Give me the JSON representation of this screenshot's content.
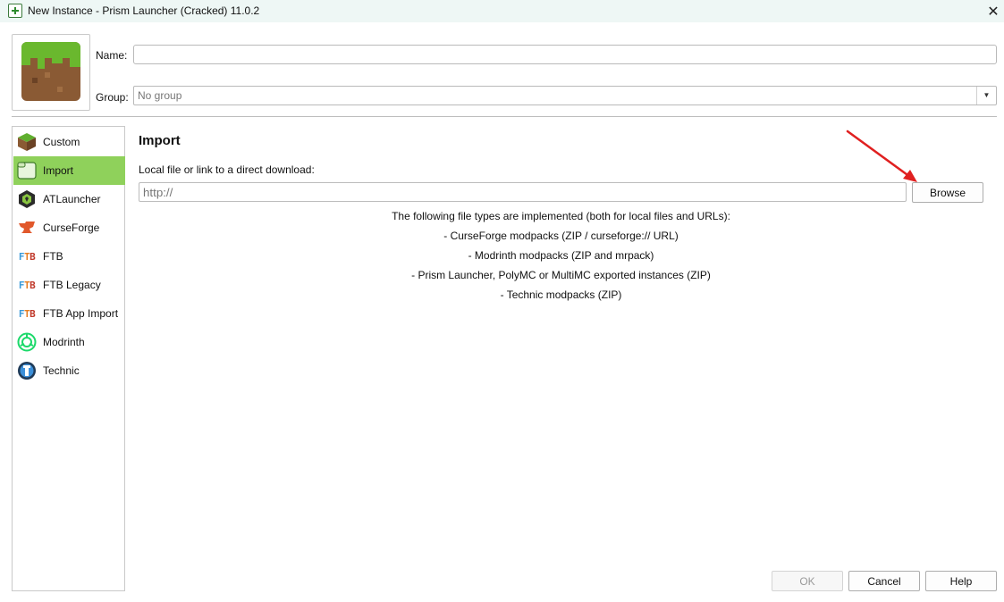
{
  "window": {
    "title": "New Instance - Prism Launcher (Cracked) 11.0.2",
    "close_glyph": "✕"
  },
  "header": {
    "name_label": "Name:",
    "name_value": "",
    "group_label": "Group:",
    "group_placeholder": "No group"
  },
  "sidebar": {
    "items": [
      {
        "label": "Custom",
        "icon": "grass-block-icon",
        "selected": false
      },
      {
        "label": "Import",
        "icon": "folder-icon",
        "selected": true
      },
      {
        "label": "ATLauncher",
        "icon": "atlauncher-icon",
        "selected": false
      },
      {
        "label": "CurseForge",
        "icon": "curseforge-icon",
        "selected": false
      },
      {
        "label": "FTB",
        "icon": "ftb-icon",
        "selected": false
      },
      {
        "label": "FTB Legacy",
        "icon": "ftb-icon",
        "selected": false
      },
      {
        "label": "FTB App Import",
        "icon": "ftb-icon",
        "selected": false
      },
      {
        "label": "Modrinth",
        "icon": "modrinth-icon",
        "selected": false
      },
      {
        "label": "Technic",
        "icon": "technic-icon",
        "selected": false
      }
    ]
  },
  "main": {
    "title": "Import",
    "local_label": "Local file or link to a direct download:",
    "url_placeholder": "http://",
    "browse_label": "Browse",
    "info_lines": [
      "The following file types are implemented (both for local files and URLs):",
      "- CurseForge modpacks (ZIP / curseforge:// URL)",
      "- Modrinth modpacks (ZIP and mrpack)",
      "- Prism Launcher, PolyMC or MultiMC exported instances (ZIP)",
      "- Technic modpacks (ZIP)"
    ]
  },
  "footer": {
    "ok_label": "OK",
    "cancel_label": "Cancel",
    "help_label": "Help"
  },
  "colors": {
    "selected_bg": "#8fd15b",
    "annotation_arrow": "#e02020"
  }
}
